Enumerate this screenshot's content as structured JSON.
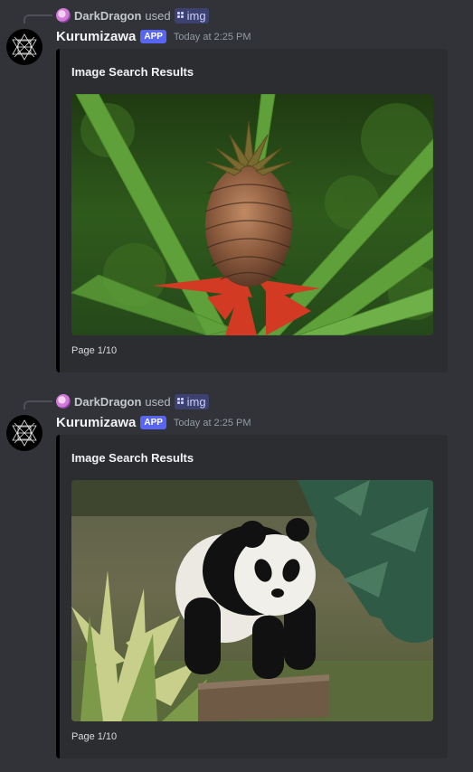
{
  "messages": [
    {
      "reply": {
        "user": "DarkDragon",
        "used": "used",
        "command": "img"
      },
      "author": "Kurumizawa",
      "tag": "APP",
      "timestamp": "Today at 2:25 PM",
      "embed": {
        "title": "Image Search Results",
        "image_icon": "pineapple-photo",
        "footer": "Page 1/10"
      }
    },
    {
      "reply": {
        "user": "DarkDragon",
        "used": "used",
        "command": "img"
      },
      "author": "Kurumizawa",
      "tag": "APP",
      "timestamp": "Today at 2:25 PM",
      "embed": {
        "title": "Image Search Results",
        "image_icon": "panda-photo",
        "footer": "Page 1/10"
      }
    }
  ],
  "colors": {
    "background": "#313338",
    "embed_background": "#2b2d31",
    "embed_border": "#000000",
    "app_tag": "#5865f2"
  }
}
